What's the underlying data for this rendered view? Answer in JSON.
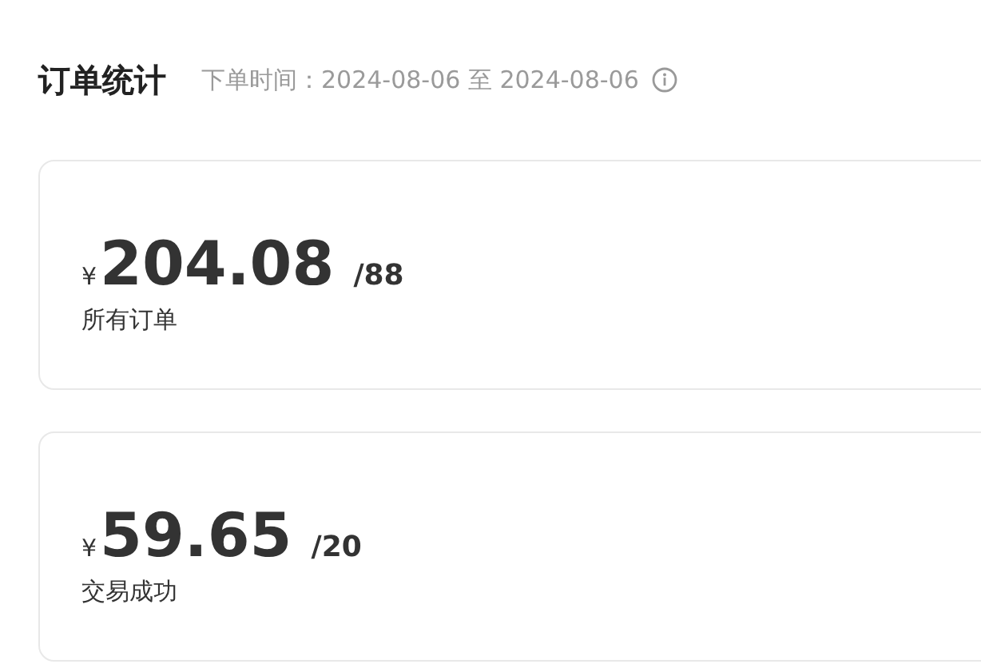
{
  "header": {
    "title": "订单统计",
    "date_range": "下单时间：2024-08-06 至 2024-08-06"
  },
  "cards": [
    {
      "currency": "¥",
      "amount": "204.08",
      "count": "/88",
      "label": "所有订单"
    },
    {
      "currency": "¥",
      "amount": "59.65",
      "count": "/20",
      "label": "交易成功"
    }
  ]
}
